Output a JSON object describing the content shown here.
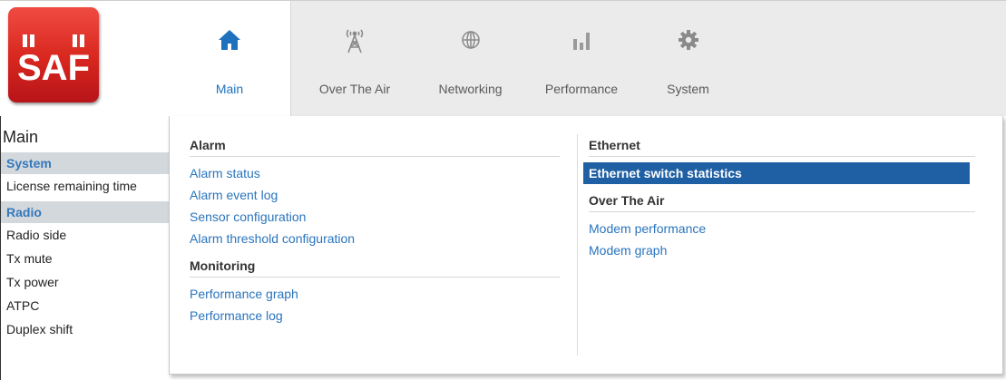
{
  "logo": {
    "text": "SAF"
  },
  "nav": {
    "items": [
      {
        "label": "Main",
        "icon": "home-icon",
        "active": true
      },
      {
        "label": "Over The Air",
        "icon": "antenna-icon",
        "active": false
      },
      {
        "label": "Networking",
        "icon": "globe-icon",
        "active": false
      },
      {
        "label": "Performance",
        "icon": "bar-chart-icon",
        "active": false
      },
      {
        "label": "System",
        "icon": "gear-icon",
        "active": false
      }
    ]
  },
  "sidebar": {
    "title": "Main",
    "sections": [
      {
        "header": "System",
        "rows": [
          "License remaining time"
        ]
      },
      {
        "header": "Radio",
        "rows": [
          "Radio side",
          "Tx mute",
          "Tx power",
          "ATPC",
          "Duplex shift"
        ]
      }
    ]
  },
  "dropdown": {
    "left": [
      {
        "header": "Alarm",
        "links": [
          "Alarm status",
          "Alarm event log",
          "Sensor configuration",
          "Alarm threshold configuration"
        ]
      },
      {
        "header": "Monitoring",
        "links": [
          "Performance graph",
          "Performance log"
        ]
      }
    ],
    "right": [
      {
        "header": "Ethernet",
        "links": [
          "Ethernet switch statistics"
        ]
      },
      {
        "header": "Over The Air",
        "links": [
          "Modem performance",
          "Modem graph"
        ]
      }
    ],
    "selected_link": "Ethernet switch statistics"
  },
  "colors": {
    "accent": "#1e72bd",
    "selected_bg": "#1f5fa3",
    "logo_red": "#d7261e",
    "section_bg": "#d3d8dc"
  }
}
